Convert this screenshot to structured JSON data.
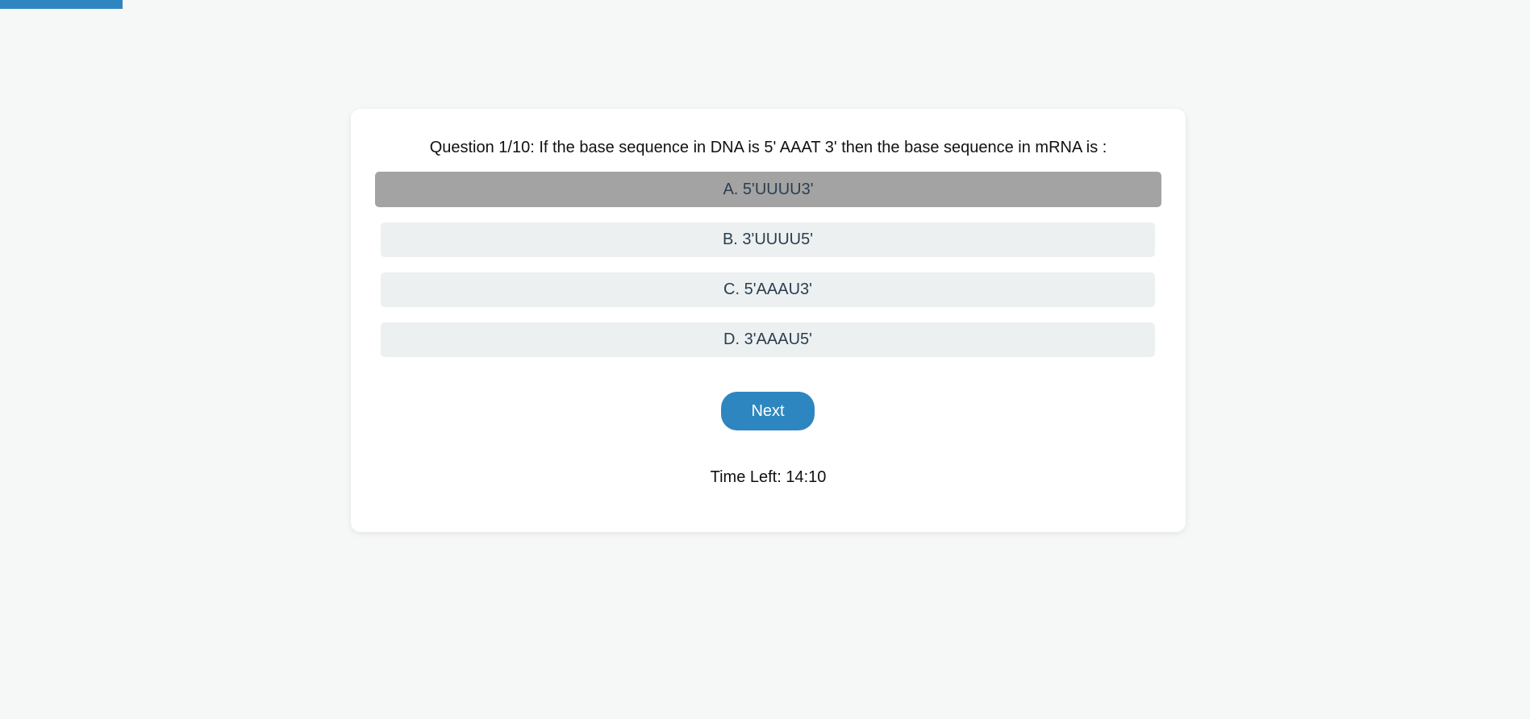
{
  "progress": {
    "fraction": 0.08,
    "color": "#2e86c1"
  },
  "quiz": {
    "question": "Question 1/10: If the base sequence in DNA is 5' AAAT 3' then the base sequence in mRNA is :",
    "options": [
      {
        "label": "A. 5'UUUU3'",
        "selected": true
      },
      {
        "label": "B. 3'UUUU5'",
        "selected": false
      },
      {
        "label": "C. 5'AAAU3'",
        "selected": false
      },
      {
        "label": "D. 3'AAAU5'",
        "selected": false
      }
    ],
    "next_label": "Next",
    "timer_text": "Time Left: 14:10"
  },
  "colors": {
    "background": "#f6f7f7",
    "card": "#ffffff",
    "option": "#ecf0f1",
    "option_selected": "#a3a3a3",
    "accent": "#2e86c1"
  }
}
